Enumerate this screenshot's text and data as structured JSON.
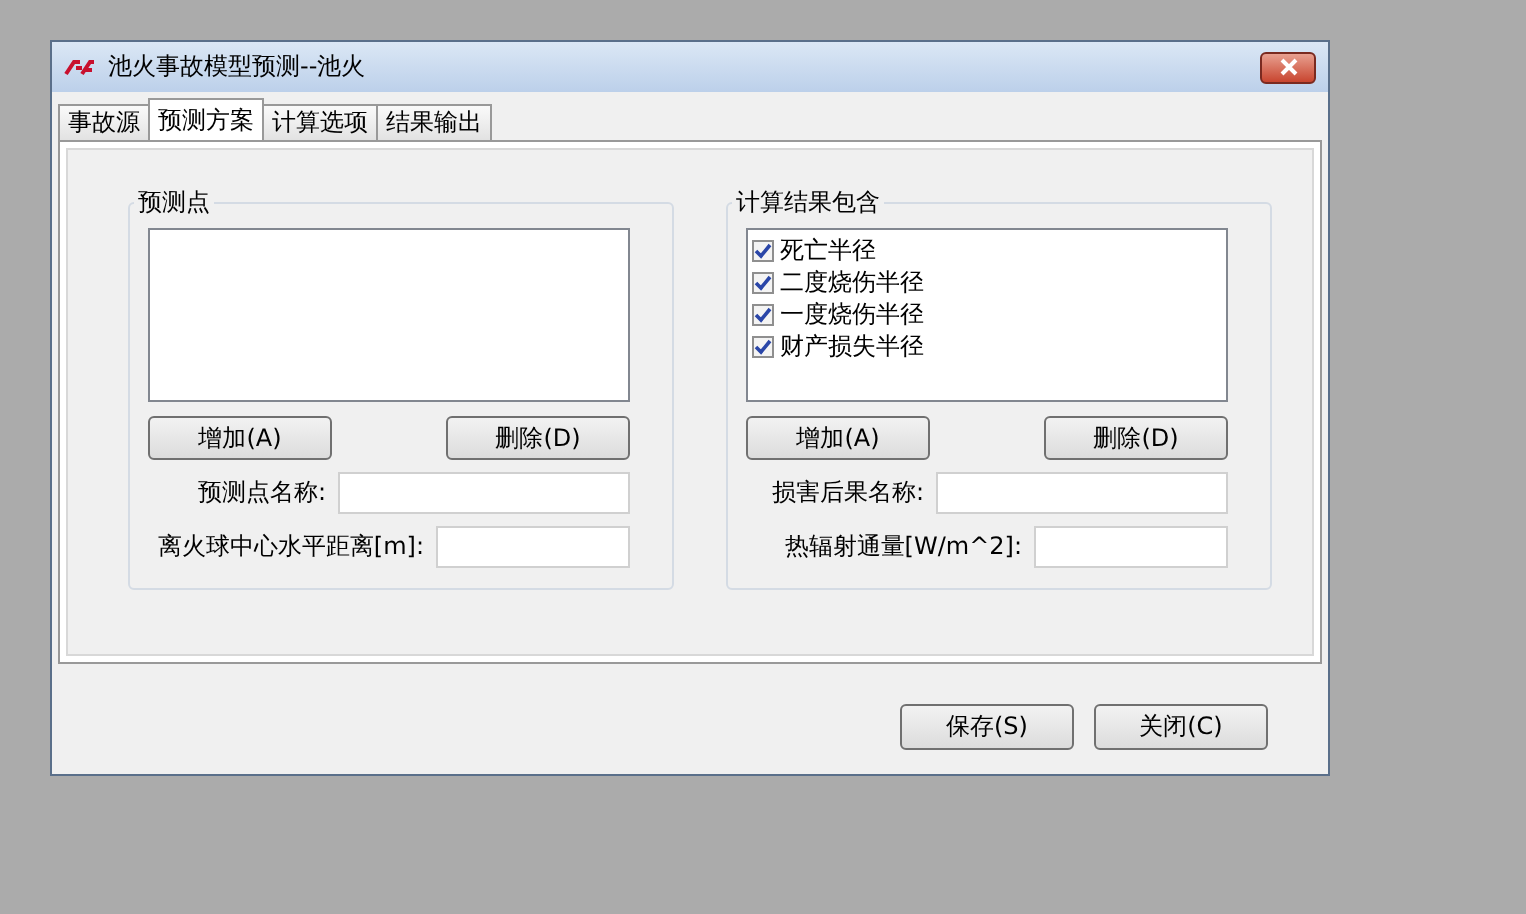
{
  "window": {
    "title": "池火事故模型预测--池火"
  },
  "tabs": [
    {
      "label": "事故源",
      "selected": false
    },
    {
      "label": "预测方案",
      "selected": true
    },
    {
      "label": "计算选项",
      "selected": false
    },
    {
      "label": "结果输出",
      "selected": false
    }
  ],
  "groups": [
    {
      "title": "预测点",
      "buttons": [
        "增加(A)",
        "删除(D)"
      ],
      "fields": [
        {
          "label": "预测点名称:"
        },
        {
          "label": "离火球中心水平距离[m]:"
        }
      ]
    },
    {
      "title": "计算结果包含",
      "list": [
        {
          "label": "死亡半径",
          "checked": true
        },
        {
          "label": "二度烧伤半径",
          "checked": true
        },
        {
          "label": "一度烧伤半径",
          "checked": true
        },
        {
          "label": "财产损失半径",
          "checked": true
        }
      ],
      "buttons": [
        "增加(A)",
        "删除(D)"
      ],
      "fields": [
        {
          "label": "损害后果名称:"
        },
        {
          "label": "热辐射通量[W/m^2]:"
        }
      ]
    }
  ],
  "footer_buttons": [
    "保存(S)",
    "关闭(C)"
  ]
}
